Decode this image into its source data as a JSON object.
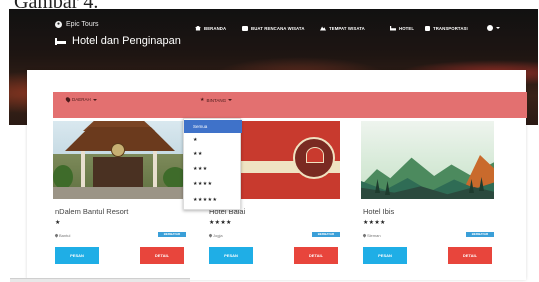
{
  "top_fragment": "Gambar 4.",
  "hero": {
    "brand": "Epic Tours",
    "title": "Hotel dan Penginapan"
  },
  "nav": {
    "items": [
      {
        "label": "BERANDA",
        "icon": "home-icon"
      },
      {
        "label": "BUAT RENCANA WISATA",
        "icon": "calendar-icon"
      },
      {
        "label": "TEMPAT WISATA",
        "icon": "mountain-icon"
      },
      {
        "label": "HOTEL",
        "icon": "bed-icon"
      },
      {
        "label": "TRANSPORTASI",
        "icon": "bus-icon"
      }
    ],
    "settings_icon": "gear-icon"
  },
  "filters": {
    "daerah_label": "DAERAH",
    "bintang_label": "BINTANG",
    "bintang_icon": "★"
  },
  "dropdown": {
    "options": [
      "Semua",
      "★",
      "★★",
      "★★★",
      "★★★★",
      "★★★★★"
    ],
    "selected": "Semua"
  },
  "hotels": [
    {
      "name": "nDalem Bantul Resort",
      "stars": "★",
      "location": "Bantul",
      "tag": "BERBAYAR",
      "pesan": "PESAN",
      "detail": "DETAIL"
    },
    {
      "name": "Hotel Balai",
      "stars": "★★★★",
      "location": "Jogja",
      "tag": "BERBAYAR",
      "pesan": "PESAN",
      "detail": "DETAIL"
    },
    {
      "name": "Hotel Ibis",
      "stars": "★★★★",
      "location": "Sleman",
      "tag": "BERBAYAR",
      "pesan": "PESAN",
      "detail": "DETAIL"
    }
  ],
  "colors": {
    "filter_bar": "#e37070",
    "pesan_button": "#1faee6",
    "detail_button": "#e8453c",
    "tag": "#3a9fd8",
    "dropdown_selected": "#3f72c9"
  }
}
